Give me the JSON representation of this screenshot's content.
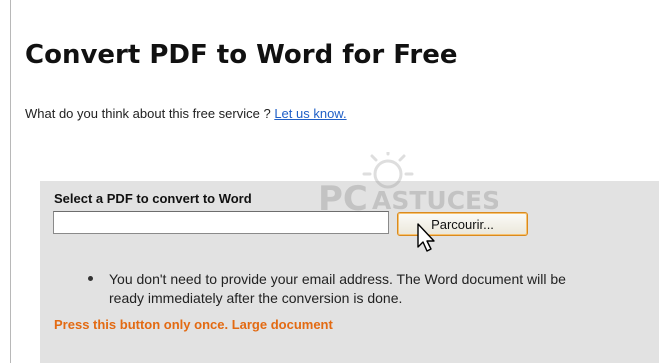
{
  "page": {
    "title": "Convert PDF to Word for Free",
    "feedback_question": "What do you think about this free service ? ",
    "feedback_link": "Let us know."
  },
  "upload": {
    "label": "Select a PDF to convert to Word",
    "file_value": "",
    "browse_label": "Parcourir..."
  },
  "notes": [
    "You don't need to provide your email address. The Word document will be\nready immediately after the conversion is done."
  ],
  "warning": "Press this button only once. Large document",
  "watermark": {
    "text": "PC ASTUCES"
  },
  "colors": {
    "panel": "#e2e2e2",
    "link": "#1f5fc7",
    "warning": "#e36a12",
    "button_border": "#d98a1e"
  },
  "icons": {
    "cursor": "arrow-cursor-icon",
    "watermark": "pc-astuces-logo-icon"
  }
}
